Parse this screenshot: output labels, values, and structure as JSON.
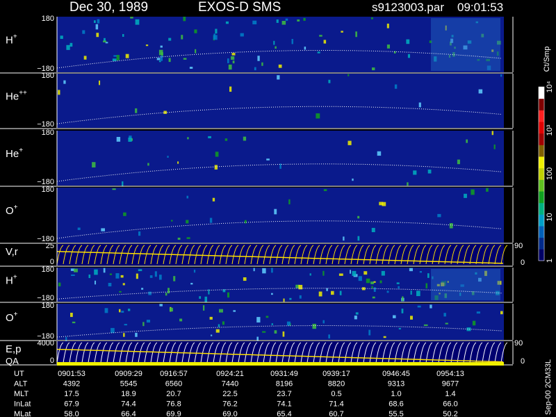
{
  "header": {
    "date": "Dec 30, 1989",
    "instrument": "EXOS-D SMS",
    "filename": "s9123003.par",
    "time": "09:01:53"
  },
  "colorbar": {
    "unit": "Ct/Smp",
    "ticks": [
      {
        "label": "1",
        "value": 1
      },
      {
        "label": "10",
        "value": 10
      },
      {
        "label": "100",
        "value": 100
      },
      {
        "label": "10³",
        "value": 1000
      },
      {
        "label": "10⁴",
        "value": 10000
      }
    ],
    "colors": [
      "#000066",
      "#002a8a",
      "#0060b8",
      "#00a0c8",
      "#00b080",
      "#10a020",
      "#60c020",
      "#c0d000",
      "#f0f000",
      "#806000",
      "#a00000",
      "#e00000",
      "#ff2020",
      "#800000",
      "#ffffff"
    ]
  },
  "panels": [
    {
      "name": "H+",
      "label": "H",
      "sup": "+",
      "ymax": "180",
      "ymin": "−180",
      "activity": 1.0
    },
    {
      "name": "He++",
      "label": "He",
      "sup": "++",
      "ymax": "180",
      "ymin": "−180",
      "activity": 0.15
    },
    {
      "name": "He+",
      "label": "He",
      "sup": "+",
      "ymax": "180",
      "ymin": "−180",
      "activity": 0.3
    },
    {
      "name": "O+",
      "label": "O",
      "sup": "+",
      "ymax": "180",
      "ymin": "−180",
      "activity": 0.3
    },
    {
      "name": "V,r",
      "label": "V,r",
      "sup": "",
      "ymax": "25",
      "ymin": "0",
      "right_top": "90",
      "right_bottom": "0"
    },
    {
      "name": "H+ (2)",
      "label": "H",
      "sup": "+",
      "ymax": "180",
      "ymin": "−180",
      "activity": 1.0
    },
    {
      "name": "O+ (2)",
      "label": "O",
      "sup": "+",
      "ymax": "180",
      "ymin": "−180",
      "activity": 0.6
    },
    {
      "name": "E,p",
      "label": "E,p",
      "sup": "",
      "ymax": "4000",
      "ymin": "0",
      "right_top": "90",
      "right_bottom": "0"
    }
  ],
  "qa_label": "QA",
  "footer": {
    "rows": [
      {
        "label": "UT",
        "values": [
          "0901:53",
          "0909:29",
          "0916:57",
          "0924:21",
          "0931:49",
          "0939:17",
          "0946:45",
          "0954:13"
        ]
      },
      {
        "label": "ALT",
        "values": [
          "4392",
          "5545",
          "6560",
          "7440",
          "8196",
          "8820",
          "9313",
          "9677"
        ]
      },
      {
        "label": "MLT",
        "values": [
          "17.5",
          "18.9",
          "20.7",
          "22.5",
          "23.7",
          "0.5",
          "1.0",
          "1.4"
        ]
      },
      {
        "label": "InLat",
        "values": [
          "67.9",
          "74.4",
          "76.8",
          "76.2",
          "74.1",
          "71.4",
          "68.6",
          "66.0"
        ]
      },
      {
        "label": "MLat",
        "values": [
          "58.0",
          "66.4",
          "69.9",
          "69.0",
          "65.4",
          "60.7",
          "55.5",
          "50.2"
        ]
      }
    ],
    "stamp": "Sep-00 2CM33L"
  },
  "chart_data": {
    "type": "heatmap",
    "title": "Dec 30, 1989   EXOS-D SMS",
    "subtitle": "s9123003.par  09:01:53",
    "x": [
      "0901:53",
      "0909:29",
      "0916:57",
      "0924:21",
      "0931:49",
      "0939:17",
      "0946:45",
      "0954:13"
    ],
    "series": [
      {
        "name": "H+",
        "ylim": [
          -180,
          180
        ]
      },
      {
        "name": "He++",
        "ylim": [
          -180,
          180
        ]
      },
      {
        "name": "He+",
        "ylim": [
          -180,
          180
        ]
      },
      {
        "name": "O+",
        "ylim": [
          -180,
          180
        ]
      },
      {
        "name": "V,r",
        "ylim": [
          0,
          25
        ]
      },
      {
        "name": "H+",
        "ylim": [
          -180,
          180
        ]
      },
      {
        "name": "O+",
        "ylim": [
          -180,
          180
        ]
      },
      {
        "name": "E,p",
        "ylim": [
          0,
          4000
        ]
      }
    ],
    "colorscale": {
      "unit": "Ct/Smp",
      "range": [
        1,
        10000
      ],
      "log": true
    }
  }
}
